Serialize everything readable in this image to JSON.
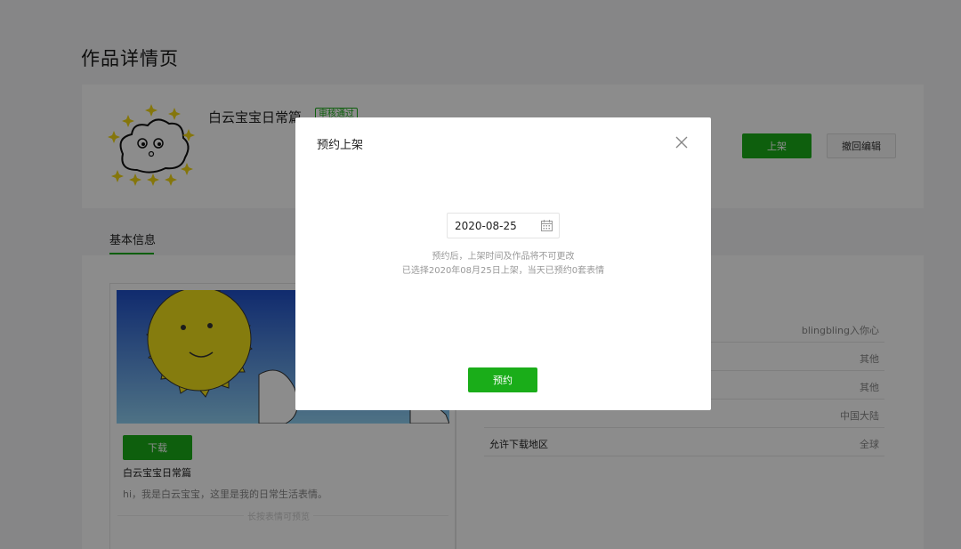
{
  "page": {
    "title": "作品详情页"
  },
  "header": {
    "work_title": "白云宝宝日常篇",
    "status": "审核通过",
    "publish_button": "上架",
    "withdraw_button": "撤回编辑"
  },
  "tabs": {
    "basic": "基本信息"
  },
  "left": {
    "download_button": "下载",
    "sticker_name": "白云宝宝日常篇",
    "description": "hi，我是白云宝宝，这里是我的日常生活表情。",
    "preview_label": "长按表情可预览"
  },
  "info_rows": [
    {
      "label": "",
      "value": "blingbling入你心"
    },
    {
      "label": "",
      "value": "其他"
    },
    {
      "label": "",
      "value": "其他"
    },
    {
      "label": "",
      "value": "中国大陆"
    },
    {
      "label": "允许下载地区",
      "value": "全球"
    }
  ],
  "modal": {
    "title": "预约上架",
    "date_value": "2020-08-25",
    "note_1": "预约后，上架时间及作品将不可更改",
    "note_2": "已选择2020年08月25日上架，当天已预约0套表情",
    "confirm_button": "预约"
  },
  "colors": {
    "accent": "#1aad19",
    "overlay": "rgba(0,0,0,0.45)"
  },
  "icons": {
    "close": "close-icon",
    "calendar": "calendar-icon"
  }
}
